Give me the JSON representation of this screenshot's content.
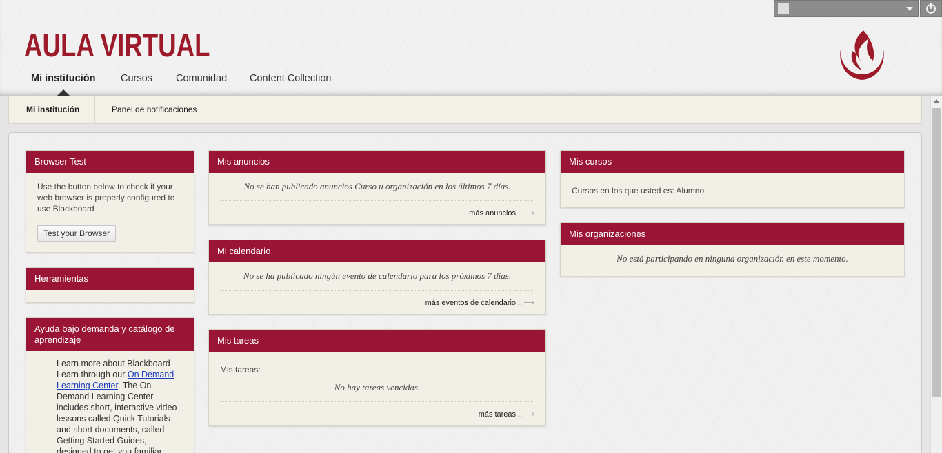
{
  "header": {
    "brand": "AULA VIRTUAL",
    "tabs": [
      "Mi institución",
      "Cursos",
      "Comunidad",
      "Content Collection"
    ],
    "active_tab": "Mi institución"
  },
  "subnav": {
    "tabs": [
      "Mi institución",
      "Panel de notificaciones"
    ],
    "active_tab": "Mi institución"
  },
  "modules": {
    "browser_test": {
      "title": "Browser Test",
      "text": "Use the button below to check if your web browser is properly configured to use Blackboard",
      "button": "Test your Browser"
    },
    "herramientas": {
      "title": "Herramientas"
    },
    "ayuda": {
      "title": "Ayuda bajo demanda y catálogo de aprendizaje",
      "text_before": "Learn more about Blackboard Learn through our ",
      "link": "On Demand Learning Center",
      "text_after": ". The On Demand Learning Center includes short, interactive video lessons called Quick Tutorials and short documents, called Getting Started Guides, designed to get you familiar"
    },
    "anuncios": {
      "title": "Mis anuncios",
      "message": "No se han publicado anuncios Curso u organización en los últimos 7 días.",
      "more": "más anuncios..."
    },
    "calendario": {
      "title": "Mi calendario",
      "message": "No se ha publicado ningún evento de calendario para los próximos 7 días.",
      "more": "más eventos de calendario..."
    },
    "tareas": {
      "title": "Mis tareas",
      "label": "Mis tareas:",
      "message": "No hay tareas vencidas.",
      "more": "más tareas..."
    },
    "cursos": {
      "title": "Mis cursos",
      "text": "Cursos en los que usted es: Alumno"
    },
    "organizaciones": {
      "title": "Mis organizaciones",
      "message": "No está participando en ninguna organización en este momento."
    }
  },
  "colors": {
    "brand_red": "#9c1a2a",
    "module_header": "#9a1535",
    "module_body": "#f2efe6"
  }
}
